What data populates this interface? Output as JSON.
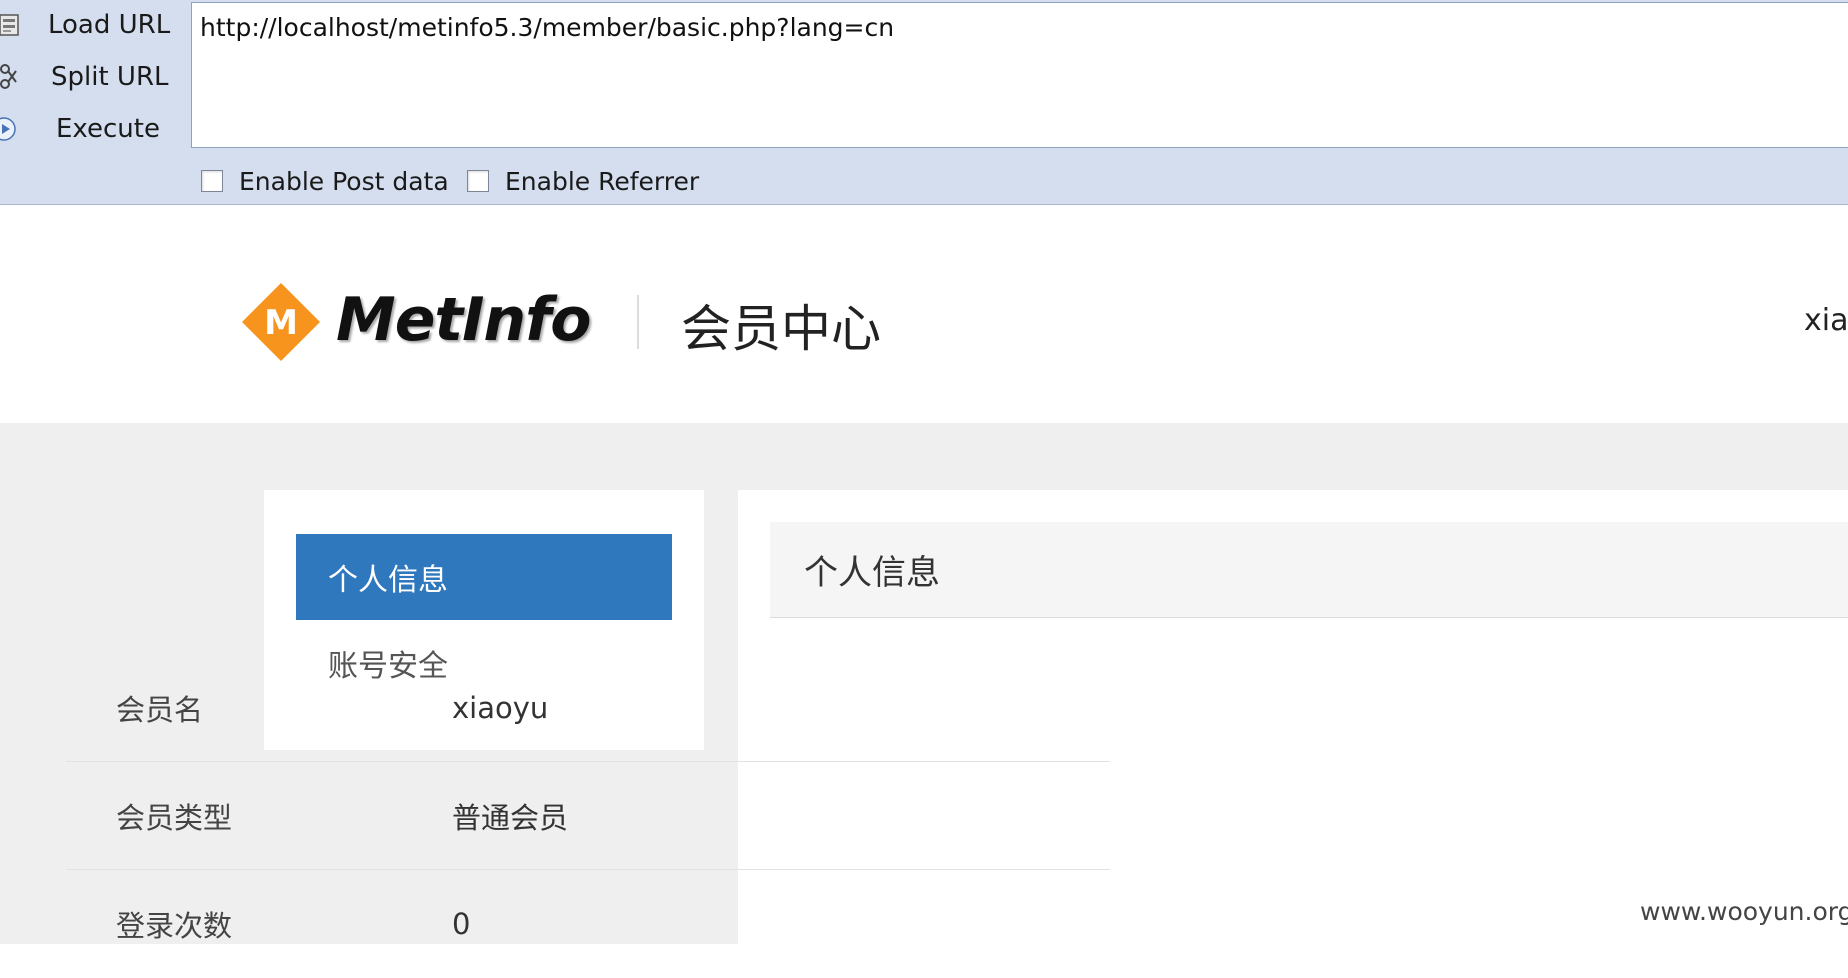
{
  "hackbar": {
    "load_url_label": "Load URL",
    "split_url_label": "Split URL",
    "execute_label": "Execute",
    "url_value": "http://localhost/metinfo5.3/member/basic.php?lang=cn",
    "enable_post_label": "Enable Post data",
    "enable_referrer_label": "Enable Referrer"
  },
  "header": {
    "logo_letter": "M",
    "logo_text": "MetInfo",
    "title": "会员中心",
    "user_partial": "xiao"
  },
  "sidebar": {
    "items": [
      {
        "label": "个人信息",
        "active": true
      },
      {
        "label": "账号安全",
        "active": false
      }
    ]
  },
  "panel": {
    "title": "个人信息",
    "rows": [
      {
        "key": "会员名",
        "value": "xiaoyu"
      },
      {
        "key": "会员类型",
        "value": "普通会员"
      },
      {
        "key": "登录次数",
        "value": "0"
      }
    ]
  },
  "watermark": "www.wooyun.org",
  "colors": {
    "hackbar_bg": "#d4deee",
    "sidebar_active": "#2f78bd",
    "logo_orange": "#f7941d",
    "content_bg": "#efefef"
  },
  "icons": {
    "load_url": "load-page-icon",
    "split_url": "scissors-icon",
    "execute": "play-icon"
  }
}
